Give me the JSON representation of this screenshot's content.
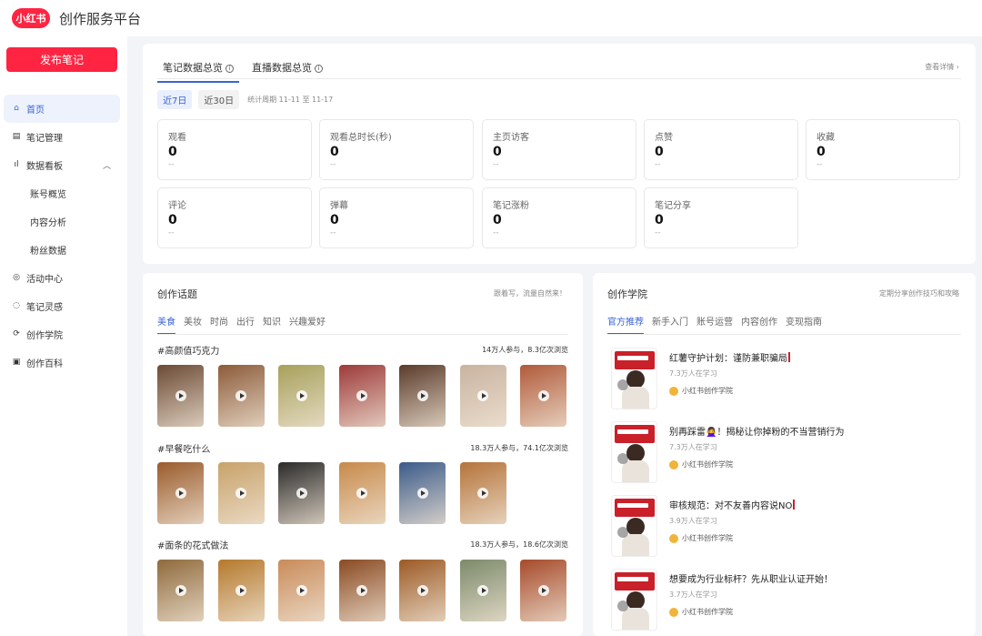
{
  "header": {
    "logo_text": "小红书",
    "title": "创作服务平台"
  },
  "sidebar": {
    "publish_label": "发布笔记",
    "items": [
      {
        "label": "首页",
        "icon": "home-icon",
        "glyph": "⌂"
      },
      {
        "label": "笔记管理",
        "icon": "note-icon",
        "glyph": "▤"
      },
      {
        "label": "数据看板",
        "icon": "chart-icon",
        "glyph": "ıl",
        "arrow": "︿"
      },
      {
        "label": "账号概览"
      },
      {
        "label": "内容分析"
      },
      {
        "label": "粉丝数据"
      },
      {
        "label": "活动中心",
        "icon": "activity-icon",
        "glyph": "◎"
      },
      {
        "label": "笔记灵感",
        "icon": "bulb-icon",
        "glyph": "◌"
      },
      {
        "label": "创作学院",
        "icon": "academy-icon",
        "glyph": "⟳"
      },
      {
        "label": "创作百科",
        "icon": "book-icon",
        "glyph": "▣"
      }
    ]
  },
  "overview": {
    "tabs": [
      "笔记数据总览",
      "直播数据总览"
    ],
    "more": "查看详情 ›",
    "ranges": [
      "近7日",
      "近30日"
    ],
    "range_note": "统计周期 11-11 至 11-17",
    "metrics": [
      {
        "label": "观看",
        "value": "0",
        "delta": "--"
      },
      {
        "label": "观看总时长(秒)",
        "value": "0",
        "delta": "--"
      },
      {
        "label": "主页访客",
        "value": "0",
        "delta": "--"
      },
      {
        "label": "点赞",
        "value": "0",
        "delta": "--"
      },
      {
        "label": "收藏",
        "value": "0",
        "delta": "--"
      },
      {
        "label": "评论",
        "value": "0",
        "delta": "--"
      },
      {
        "label": "弹幕",
        "value": "0",
        "delta": "--"
      },
      {
        "label": "笔记涨粉",
        "value": "0",
        "delta": "--"
      },
      {
        "label": "笔记分享",
        "value": "0",
        "delta": "--"
      }
    ]
  },
  "topics": {
    "title": "创作话题",
    "note": "跟着写，流量自然来！",
    "tabs": [
      "美食",
      "美妆",
      "时尚",
      "出行",
      "知识",
      "兴趣爱好"
    ],
    "groups": [
      {
        "name": "#高颜值巧克力",
        "stats": "14万人参与，8.3亿次浏览",
        "thumbs": [
          "#6b4a35",
          "#8c5b3a",
          "#a7a15c",
          "#9d3a3a",
          "#5a3b2b",
          "#c9b3a0",
          "#b05a3a"
        ]
      },
      {
        "name": "#早餐吃什么",
        "stats": "18.3万人参与，74.1亿次浏览",
        "thumbs": [
          "#9a5b2c",
          "#c8a26a",
          "#2a2a2a",
          "#c78a4a",
          "#3c5b8a",
          "#b5733a"
        ]
      },
      {
        "name": "#面条的花式做法",
        "stats": "18.3万人参与，18.6亿次浏览",
        "thumbs": [
          "#8f6a3c",
          "#b5792c",
          "#c98b5a",
          "#8a4a22",
          "#9c5a25",
          "#7c8a6a",
          "#a64a2a"
        ]
      }
    ]
  },
  "academy": {
    "title": "创作学院",
    "note": "定期分享创作技巧和攻略",
    "tabs": [
      "官方推荐",
      "新手入门",
      "账号运营",
      "内容创作",
      "变现指南"
    ],
    "courses": [
      {
        "title": "红薯守护计划：谨防兼职骗局",
        "meta": "7.3万人在学习",
        "author": "小红书创作学院"
      },
      {
        "title": "别再踩雷🙅‍♀️！揭秘让你掉粉的不当营销行为",
        "meta": "7.3万人在学习",
        "author": "小红书创作学院"
      },
      {
        "title": "审核规范：对不友善内容说NO",
        "meta": "3.9万人在学习",
        "author": "小红书创作学院"
      },
      {
        "title": "想要成为行业标杆？先从职业认证开始！",
        "meta": "3.7万人在学习",
        "author": "小红书创作学院"
      }
    ]
  },
  "colors": {
    "brand": "#ff2442",
    "accent": "#3a64d8"
  }
}
